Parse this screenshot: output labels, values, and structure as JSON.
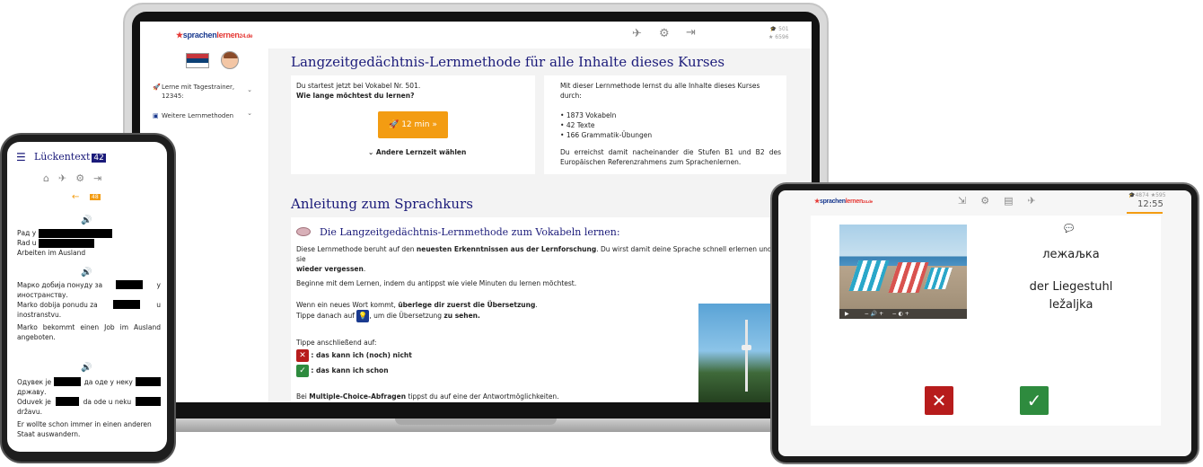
{
  "brand": {
    "part1": "sprachen",
    "part2": "lernen",
    "suffix": "24.de"
  },
  "laptop": {
    "stats": {
      "s1": "501",
      "s2": "6596"
    },
    "sidebar": {
      "item1": "Lerne mit Tagestrainer,",
      "item1b": "12345:",
      "item2": "Weitere Lernmethoden"
    },
    "title1": "Langzeitgedächtnis-Lernmethode für alle Inhalte dieses Kurses",
    "left_card": {
      "line1": "Du startest jetzt bei Vokabel Nr. 501.",
      "line2": "Wie lange möchtest du lernen?",
      "button": "12 min",
      "other": "Andere Lernzeit wählen"
    },
    "right_card": {
      "intro": "Mit dieser Lernmethode lernst du alle Inhalte dieses Kurses durch:",
      "items": [
        "1873 Vokabeln",
        "42 Texte",
        "166 Grammatik-Übungen"
      ],
      "outro": "Du erreichst damit nacheinander die Stufen B1 und B2 des Europäischen Referenzrahmens zum Sprachenlernen."
    },
    "title2": "Anleitung zum Sprachkurs",
    "guide": {
      "subtitle": "Die Langzeitgedächtnis-Lernmethode zum Vokabeln lernen:",
      "p1a": "Diese Lernmethode beruht auf den ",
      "p1b": "neuesten Erkenntnissen aus der Lernforschung",
      "p1c": ". Du wirst damit deine Sprache schnell erlernen und sie",
      "p1d": "wieder vergessen",
      "p2": "Beginne mit dem Lernen, indem du antippst wie viele Minuten du lernen möchtest.",
      "p3a": "Wenn ein neues Wort kommt, ",
      "p3b": "überlege dir zuerst die Übersetzung",
      "p3c": "Tippe danach auf",
      "p3d": ", um die Übersetzung ",
      "p3e": "zu sehen.",
      "p4": "Tippe anschließend auf:",
      "opt1": ": das kann ich (noch) nicht",
      "opt2": ": das kann ich schon",
      "p5a": "Bei ",
      "p5b": "Multiple-Choice-Abfragen",
      "p5c": " tippst du auf eine der Antwortmöglichkeiten."
    }
  },
  "phone": {
    "title": "Lückentext",
    "badge": "42",
    "badge2": "48",
    "lines": {
      "l1a": "Рад у",
      "l1b": "Rad u",
      "l1c": "Arbeiten im Ausland",
      "l2a": "Марко добија понуду за",
      "l2a2": "у",
      "l2b": "иностранству.",
      "l2c": "Marko dobija ponudu za",
      "l2c2": "u",
      "l2d": "inostranstvu.",
      "l2e": "Marko bekommt einen Job im Ausland angeboten.",
      "l3a": "Одувек је",
      "l3a2": "да оде у неку",
      "l3b": "државу.",
      "l3c": "Oduvek je",
      "l3c2": "da ode u neku",
      "l3d": "državu.",
      "l3e": "Er wollte schon immer in einen anderen Staat auswandern."
    }
  },
  "tablet": {
    "stats": {
      "s1": "4874",
      "s2": "595"
    },
    "time": "12:55",
    "word_cyr": "лежаљка",
    "word_de": "der Liegestuhl",
    "word_lat": "ležaljka"
  },
  "colors": {
    "navy": "#1b1b7a",
    "orange": "#f39c12",
    "red": "#b71c1c",
    "green": "#2e8b3e"
  }
}
